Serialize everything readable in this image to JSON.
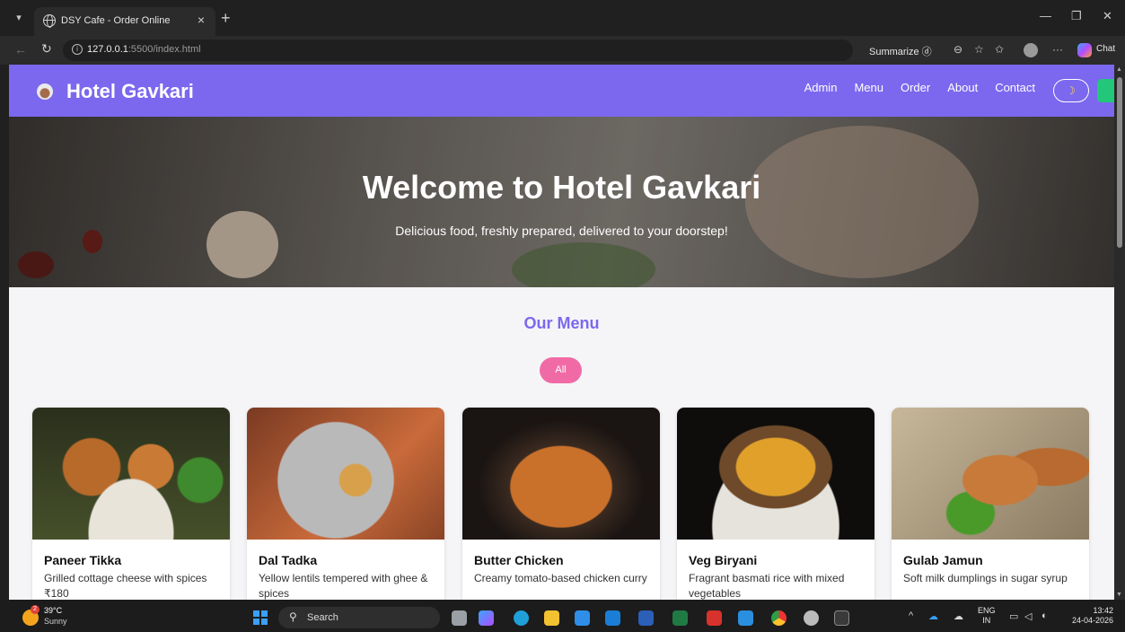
{
  "browser": {
    "tab_title": "DSY Cafe - Order Online",
    "tab_close": "×",
    "new_tab": "+",
    "url_host": "127.0.0.1",
    "url_path": ":5500/index.html",
    "summarize_label": "Summarize",
    "chat_label": "Chat"
  },
  "site": {
    "brand": "Hotel Gavkari",
    "nav": [
      "Admin",
      "Menu",
      "Order",
      "About",
      "Contact"
    ],
    "hero_title": "Welcome to Hotel Gavkari",
    "hero_subtitle": "Delicious food, freshly prepared, delivered to your doorstep!",
    "menu_title": "Our Menu",
    "filter_all": "All",
    "colors": {
      "header": "#7b68ee",
      "filter": "#f06ba6",
      "accent_green": "#22c77a"
    }
  },
  "menu_items": [
    {
      "name": "Paneer Tikka",
      "desc": "Grilled cottage cheese with spices",
      "price": "₹180"
    },
    {
      "name": "Dal Tadka",
      "desc": "Yellow lentils tempered with ghee & spices"
    },
    {
      "name": "Butter Chicken",
      "desc": "Creamy tomato-based chicken curry"
    },
    {
      "name": "Veg Biryani",
      "desc": "Fragrant basmati rice with mixed vegetables"
    },
    {
      "name": "Gulab Jamun",
      "desc": "Soft milk dumplings in sugar syrup"
    }
  ],
  "taskbar": {
    "weather_temp": "39°C",
    "weather_desc": "Sunny",
    "weather_badge": "2",
    "search_label": "Search",
    "lang_top": "ENG",
    "lang_bottom": "IN",
    "time": "13:42",
    "date": "24-04-2026"
  }
}
